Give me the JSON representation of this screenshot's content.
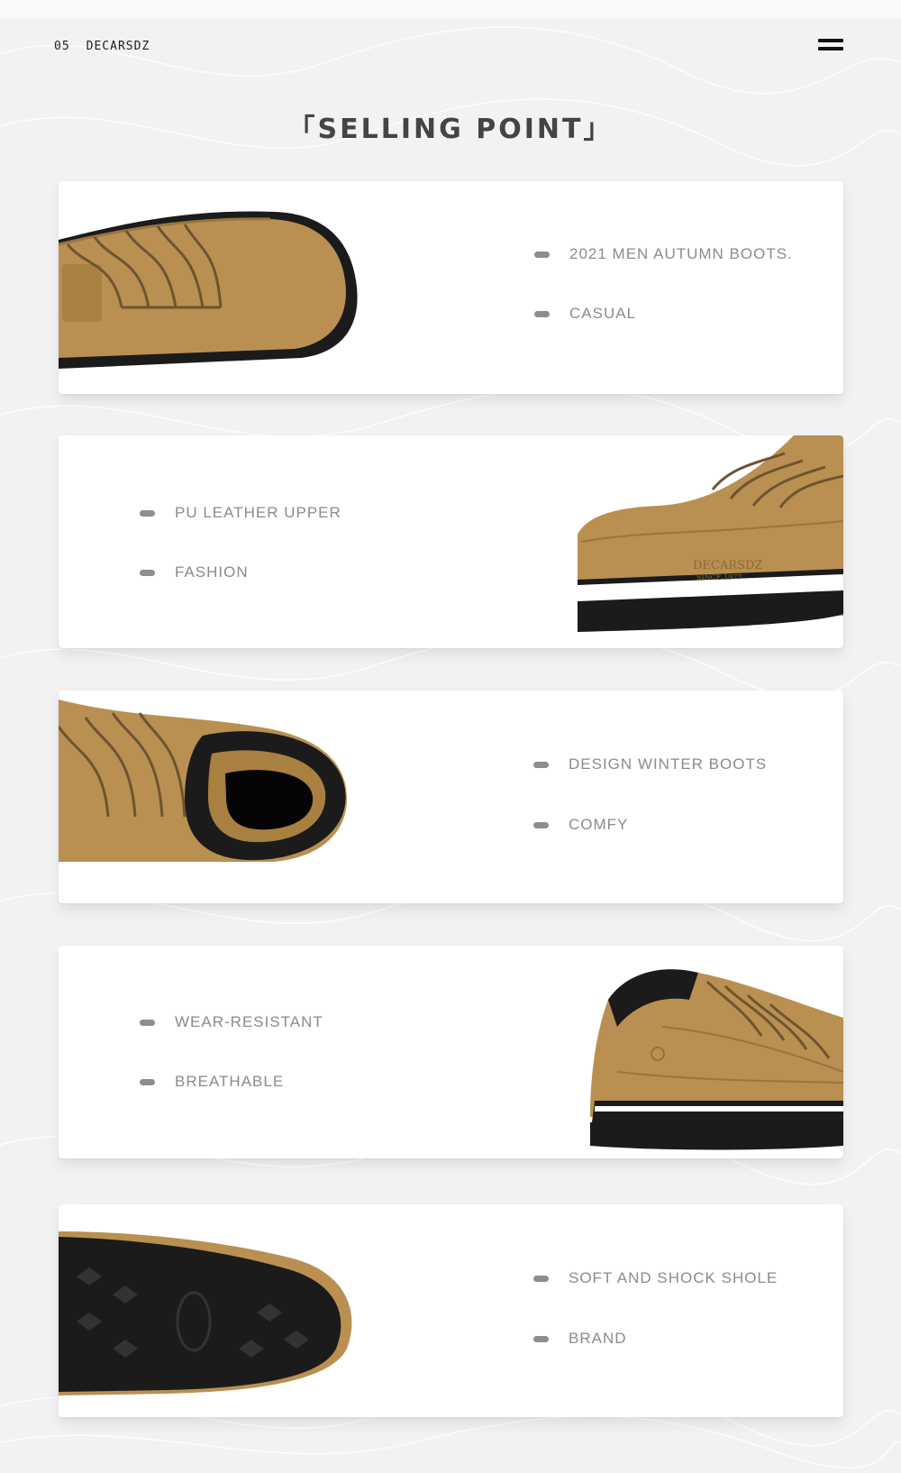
{
  "header": {
    "page_number": "05",
    "brand": "DECARSDZ",
    "menu_icon": "hamburger-menu-icon"
  },
  "title": "「SELLING POINT」",
  "colors": {
    "leather": "#b99051",
    "sole": "#1b1b1b",
    "text": "#8b8b8b",
    "title": "#444444"
  },
  "cards": [
    {
      "features": [
        "2021 MEN AUTUMN BOOTS.",
        "CASUAL"
      ]
    },
    {
      "features": [
        "PU LEATHER UPPER",
        "FASHION"
      ]
    },
    {
      "features": [
        "DESIGN WINTER BOOTS",
        "COMFY"
      ]
    },
    {
      "features": [
        "WEAR-RESISTANT",
        "BREATHABLE"
      ]
    },
    {
      "features": [
        "SOFT AND SHOCK SHOLE",
        "BRAND"
      ]
    }
  ]
}
